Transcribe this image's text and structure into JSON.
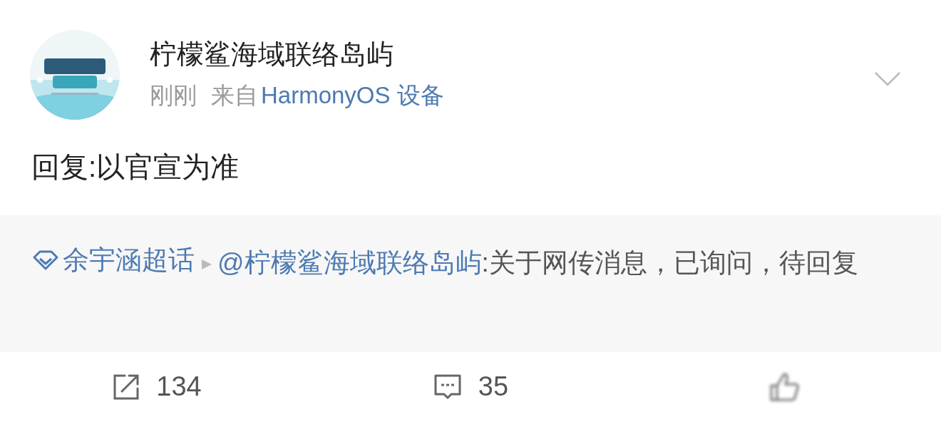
{
  "post": {
    "author": "柠檬鲨海域联络岛屿",
    "time": "刚刚",
    "source_prefix": "来自",
    "source": "HarmonyOS 设备",
    "text": "回复:以官宣为准"
  },
  "quote": {
    "topic": "余宇涵超话",
    "mention": "@柠檬鲨海域联络岛屿",
    "text": ":关于网传消息，已询问，待回复"
  },
  "actions": [
    {
      "kind": "repost",
      "count": "134"
    },
    {
      "kind": "comment",
      "count": "35"
    },
    {
      "kind": "like"
    }
  ]
}
